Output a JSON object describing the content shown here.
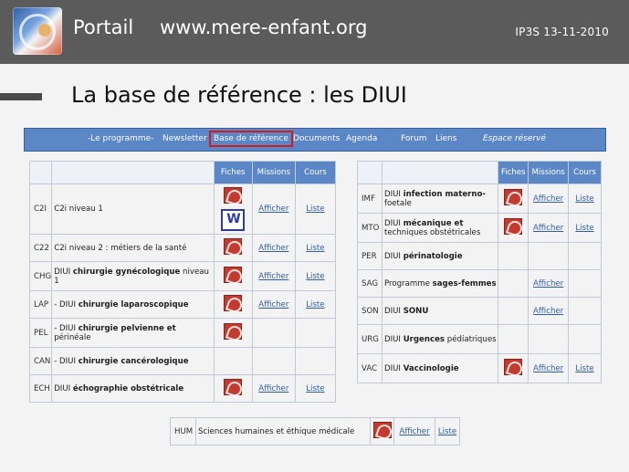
{
  "header": {
    "title": "Portail",
    "url": "www.mere-enfant.org",
    "tag": "IP3S 13-11-2010"
  },
  "page": {
    "heading": "La base de référence : les DIUI"
  },
  "nav": {
    "items": [
      {
        "label": "-Le programme-"
      },
      {
        "label": "Newsletter"
      },
      {
        "label": "Base de référence",
        "active": true
      },
      {
        "label": "Documents"
      },
      {
        "label": "Agenda"
      },
      {
        "label": "Forum"
      },
      {
        "label": "Liens"
      },
      {
        "label": "Espace réservé",
        "italic": true
      }
    ]
  },
  "tables": {
    "left": {
      "headers": [
        "",
        "",
        "Fiches",
        "Missions",
        "Cours"
      ],
      "rows": [
        {
          "code": "C2I",
          "label": "C2i niveau 1",
          "fiches": [
            "pdf",
            "word"
          ],
          "missions": "Afficher",
          "cours": "Liste"
        },
        {
          "code": "C22",
          "label": "C2i niveau 2 : métiers de la santé",
          "fiches": [
            "pdf"
          ],
          "missions": "Afficher",
          "cours": "Liste"
        },
        {
          "code": "CHG",
          "label": "DIUI chirurgie gynécologique niveau 1",
          "fiches": [
            "pdf"
          ],
          "missions": "Afficher",
          "cours": "Liste"
        },
        {
          "code": "LAP",
          "label": "- DIUI chirurgie laparoscopique",
          "fiches": [
            "pdf"
          ],
          "missions": "Afficher",
          "cours": "Liste"
        },
        {
          "code": "PEL",
          "label": "- DIUI chirurgie pelvienne et périnéale",
          "fiches": [
            "pdf"
          ],
          "missions": "",
          "cours": ""
        },
        {
          "code": "CAN",
          "label": "- DIUI chirurgie cancérologique",
          "fiches": [],
          "missions": "",
          "cours": ""
        },
        {
          "code": "ECH",
          "label": "DIUI échographie obstétricale",
          "fiches": [
            "pdf"
          ],
          "missions": "Afficher",
          "cours": "Liste"
        }
      ]
    },
    "right": {
      "headers": [
        "",
        "",
        "Fiches",
        "Missions",
        "Cours"
      ],
      "rows": [
        {
          "code": "IMF",
          "label": "DIUI infection materno-foetale",
          "fiches": [
            "pdf"
          ],
          "missions": "Afficher",
          "cours": "Liste"
        },
        {
          "code": "MTO",
          "label": "DIUI mécanique et techniques obstétricales",
          "fiches": [
            "pdf"
          ],
          "missions": "Afficher",
          "cours": "Liste"
        },
        {
          "code": "PER",
          "label": "DIUI périnatologie",
          "fiches": [],
          "missions": "",
          "cours": ""
        },
        {
          "code": "SAG",
          "label": "Programme sages-femmes",
          "fiches": [],
          "missions": "Afficher",
          "cours": ""
        },
        {
          "code": "SON",
          "label": "DIUI SONU",
          "fiches": [],
          "missions": "Afficher",
          "cours": ""
        },
        {
          "code": "URG",
          "label": "DIUI Urgences pédiatriques",
          "fiches": [],
          "missions": "",
          "cours": ""
        },
        {
          "code": "VAC",
          "label": "DIUI Vaccinologie",
          "fiches": [
            "pdf"
          ],
          "missions": "Afficher",
          "cours": "Liste"
        }
      ]
    },
    "bottom": {
      "row": {
        "code": "HUM",
        "label": "Sciences humaines et éthique médicale",
        "fiches": [
          "pdf"
        ],
        "missions": "Afficher",
        "cours": "Liste"
      }
    }
  },
  "colors": {
    "nav_blue": "#5b87c6",
    "active_outline": "#d21b1b",
    "pdf_red": "#c33a2f",
    "link_blue": "#2f5ea8"
  }
}
